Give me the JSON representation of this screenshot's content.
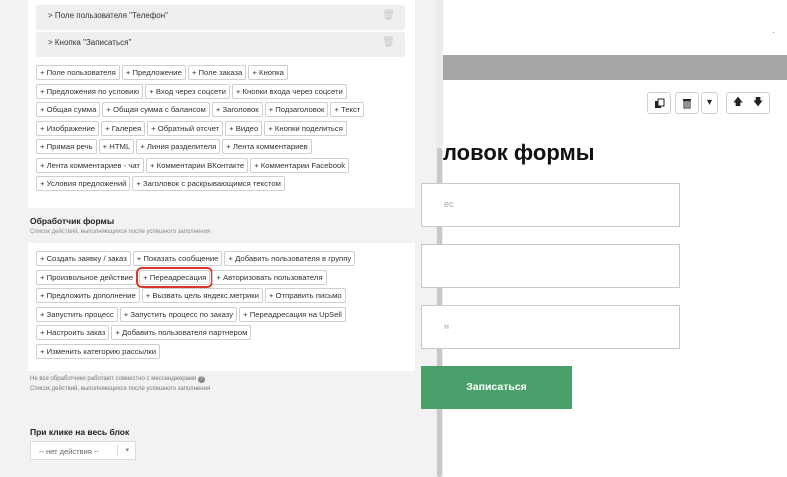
{
  "fields": [
    {
      "label": "> Поле пользователя \"Телефон\""
    },
    {
      "label": "> Кнопка \"Записаться\""
    }
  ],
  "add_element_rows": [
    [
      "+ Поле пользователя",
      "+ Предложение",
      "+ Поле заказа",
      "+ Кнопка"
    ],
    [
      "+ Предложения по условию",
      "+ Вход через соцсети",
      "+ Кнопки входа через соцсети"
    ],
    [
      "+ Общая сумма",
      "+ Общая сумма с балансом",
      "+ Заголовок",
      "+ Подзаголовок",
      "+ Текст"
    ],
    [
      "+ Изображение",
      "+ Галерея",
      "+ Обратный отсчет",
      "+ Видео",
      "+ Кнопки поделиться"
    ],
    [
      "+ Прямая речь",
      "+ HTML",
      "+ Линия разделителя",
      "+ Лента комментариев"
    ],
    [
      "+ Лента комментариев - чат",
      "+ Комментарии ВКонтакте",
      "+ Комментарии Facebook"
    ],
    [
      "+ Условия предложений",
      "+ Заголовок с раскрывающимся текстом"
    ]
  ],
  "handler_section": {
    "title": "Обработчик формы",
    "subtitle": "Список действий, выполняющихся после успешного заполнения",
    "rows": [
      [
        "+ Создать заявку / заказ",
        "+ Показать сообщение",
        "+ Добавить пользователя в группу"
      ],
      [
        "+ Произвольное действие",
        "+ Переадресация",
        "+ Авторизовать пользователя"
      ],
      [
        "+ Предложить дополнение",
        "+ Вызвать цель яндекс.метрики",
        "+ Отправить письмо"
      ],
      [
        "+ Запустить процесс",
        "+ Запустить процесс по заказу",
        "+ Переадресация на UpSell"
      ],
      [
        "+ Настроить заказ",
        "+ Добавить пользователя партнером"
      ],
      [
        "+ Изменить категорию рассылки"
      ]
    ],
    "highlighted": "+ Переадресация",
    "note_1": "Не все обработчики работают совместно с мессенджерами",
    "note_2": "Список действий, выполняющихся после успешного заполнения"
  },
  "click_section": {
    "title": "При клике на весь блок",
    "select_value": "-- нет действия --"
  },
  "preview": {
    "title": "ловок формы",
    "input_placeholders": [
      "ес",
      "",
      "н"
    ],
    "submit_label": "Записаться",
    "right_edge_mark": "·"
  },
  "toolbar": {
    "copy_icon": "copy-icon",
    "trash_icon": "trash-icon",
    "dropdown_icon": "caret-down-icon",
    "up_icon": "arrow-up-icon",
    "down_icon": "arrow-down-icon"
  },
  "colors": {
    "submit_bg": "#4aa06a",
    "highlight_outline": "#d9372b",
    "panel_bg": "#f2f2f2",
    "gray_band": "#a6a6a6"
  }
}
